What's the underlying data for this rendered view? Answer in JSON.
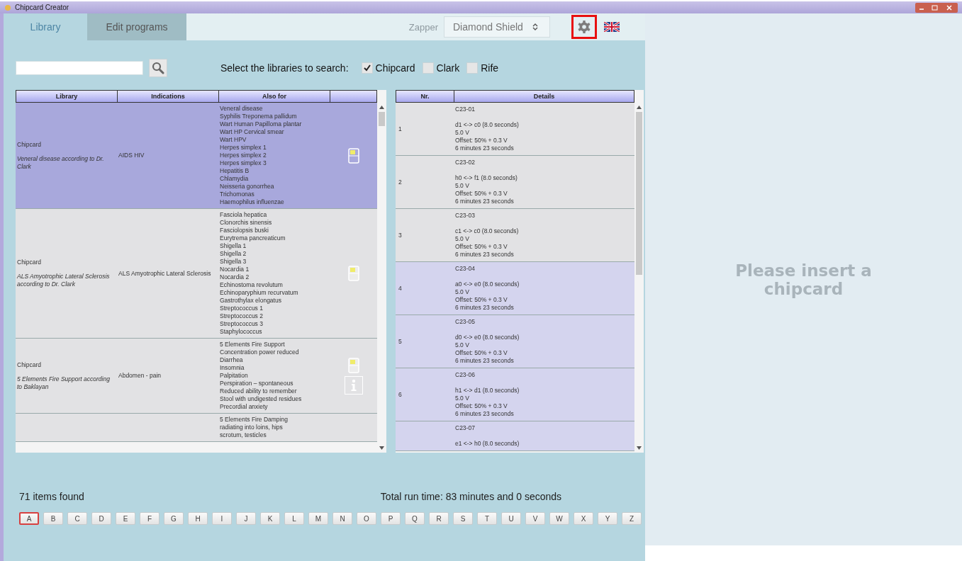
{
  "window": {
    "title": "Chipcard Creator"
  },
  "tabs": [
    {
      "label": "Library",
      "selected": true
    },
    {
      "label": "Edit programs",
      "selected": false
    }
  ],
  "zapper": {
    "label": "Zapper",
    "value": "Diamond Shield"
  },
  "library_filter": {
    "label": "Select the libraries to search:",
    "options": [
      {
        "label": "Chipcard",
        "checked": true
      },
      {
        "label": "Clark",
        "checked": false
      },
      {
        "label": "Rife",
        "checked": false
      }
    ]
  },
  "programs_table": {
    "columns": [
      "Library",
      "Indications",
      "Also for"
    ],
    "rows": [
      {
        "library": "Chipcard",
        "program": "Veneral disease according to Dr. Clark",
        "indications": "AIDS HIV",
        "also_for": [
          "Veneral disease",
          "Syphilis Treponema pallidum",
          "Wart Human Papilloma plantar",
          "Wart HP Cervical smear",
          "Wart HPV",
          "Herpes simplex 1",
          "Herpes simplex 2",
          "Herpes simplex 3",
          "Hepatitis B",
          "Chlamydia",
          "Neisseria gonorrhea",
          "Trichomonas",
          "Haemophilus influenzae"
        ],
        "selected": true,
        "chip": true,
        "info": false
      },
      {
        "library": "Chipcard",
        "program": "ALS Amyotrophic Lateral Sclerosis according to Dr. Clark",
        "indications": "ALS Amyotrophic Lateral Sclerosis",
        "also_for": [
          "Fasciola hepatica",
          "Clonorchis sinensis",
          "Fasciolopsis buski",
          "Eurytrema pancreaticum",
          "Shigella 1",
          "Shigella 2",
          "Shigella 3",
          "Nocardia 1",
          "Nocardia 2",
          "Echinostoma revolutum",
          "Echinoparyphium recurvatum",
          "Gastrothylax elongatus",
          "Streptococcus 1",
          "Streptococcus 2",
          "Streptococcus 3",
          "Staphylococcus"
        ],
        "selected": false,
        "chip": true,
        "info": false
      },
      {
        "library": "Chipcard",
        "program": "5 Elements Fire Support according to Baklayan",
        "indications": "Abdomen - pain",
        "also_for": [
          "5 Elements Fire Support",
          "Concentration power reduced",
          "Diarrhea",
          "Insomnia",
          "Palpitation",
          "Perspiration – spontaneous",
          "Reduced ability to remember",
          "Stool with undigested residues",
          "Precordial anxiety"
        ],
        "selected": false,
        "chip": true,
        "info": true
      },
      {
        "also_for": [
          "5 Elements Fire Damping",
          "radiating into loins, hips",
          "scrotum, testicles"
        ],
        "selected": false,
        "chip": false,
        "info": false
      }
    ]
  },
  "details_table": {
    "columns": [
      "Nr.",
      "Details"
    ],
    "rows": [
      {
        "nr": "1",
        "code": "C23-01",
        "lines": [
          "d1 <-> c0 (8.0 seconds)",
          "5.0 V",
          "Offset: 50% + 0.3 V",
          "6 minutes 23 seconds"
        ],
        "highlighted": false
      },
      {
        "nr": "2",
        "code": "C23-02",
        "lines": [
          "h0 <-> f1 (8.0 seconds)",
          "5.0 V",
          "Offset: 50% + 0.3 V",
          "6 minutes 23 seconds"
        ],
        "highlighted": false
      },
      {
        "nr": "3",
        "code": "C23-03",
        "lines": [
          "c1 <-> c0 (8.0 seconds)",
          "5.0 V",
          "Offset: 50% + 0.3 V",
          "6 minutes 23 seconds"
        ],
        "highlighted": false
      },
      {
        "nr": "4",
        "code": "C23-04",
        "lines": [
          "a0 <-> e0 (8.0 seconds)",
          "5.0 V",
          "Offset: 50% + 0.3 V",
          "6 minutes 23 seconds"
        ],
        "highlighted": true
      },
      {
        "nr": "5",
        "code": "C23-05",
        "lines": [
          "d0 <-> e0 (8.0 seconds)",
          "5.0 V",
          "Offset: 50% + 0.3 V",
          "6 minutes 23 seconds"
        ],
        "highlighted": true
      },
      {
        "nr": "6",
        "code": "C23-06",
        "lines": [
          "h1 <-> d1 (8.0 seconds)",
          "5.0 V",
          "Offset: 50% + 0.3 V",
          "6 minutes 23 seconds"
        ],
        "highlighted": true
      },
      {
        "code": "C23-07",
        "lines": [
          "e1 <-> h0 (8.0 seconds)"
        ],
        "highlighted": true
      }
    ]
  },
  "items_found": "71 items found",
  "total_run_time": "Total run time: 83 minutes and 0 seconds",
  "letters": [
    {
      "label": "A",
      "selected": true
    },
    {
      "label": "B",
      "selected": false
    },
    {
      "label": "C",
      "selected": false
    },
    {
      "label": "D",
      "selected": false
    },
    {
      "label": "E",
      "selected": false
    },
    {
      "label": "F",
      "selected": false
    },
    {
      "label": "G",
      "selected": false
    },
    {
      "label": "H",
      "selected": false
    },
    {
      "label": "I",
      "selected": false
    },
    {
      "label": "J",
      "selected": false
    },
    {
      "label": "K",
      "selected": false
    },
    {
      "label": "L",
      "selected": false
    },
    {
      "label": "M",
      "selected": false
    },
    {
      "label": "N",
      "selected": false
    },
    {
      "label": "O",
      "selected": false
    },
    {
      "label": "P",
      "selected": false
    },
    {
      "label": "Q",
      "selected": false
    },
    {
      "label": "R",
      "selected": false
    },
    {
      "label": "S",
      "selected": false
    },
    {
      "label": "T",
      "selected": false
    },
    {
      "label": "U",
      "selected": false
    },
    {
      "label": "V",
      "selected": false
    },
    {
      "label": "W",
      "selected": false
    },
    {
      "label": "X",
      "selected": false
    },
    {
      "label": "Y",
      "selected": false
    },
    {
      "label": "Z",
      "selected": false
    }
  ],
  "chipcard_panel": {
    "message": "Please insert a chipcard"
  }
}
